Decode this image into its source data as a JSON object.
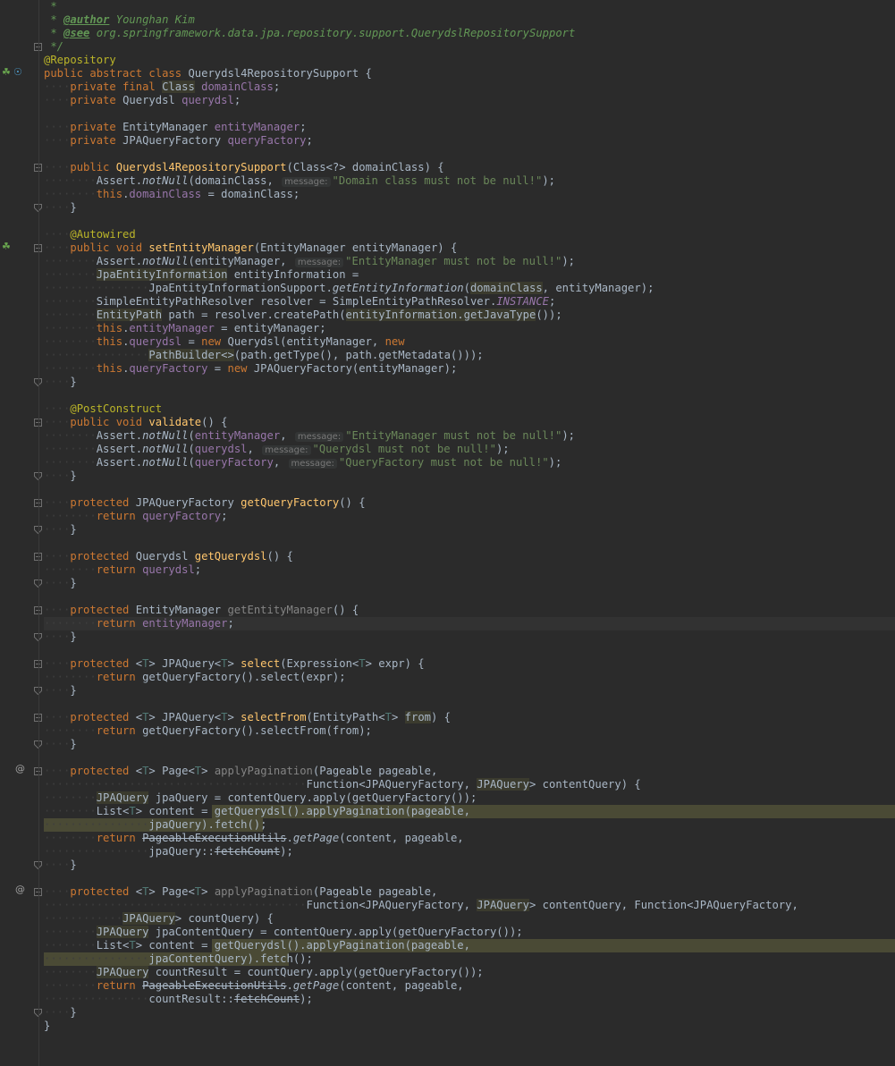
{
  "editor": {
    "lines": [
      [
        [
          "cm",
          " *"
        ]
      ],
      [
        [
          "cm",
          " * "
        ],
        [
          "tag",
          "@author"
        ],
        [
          "cm",
          " Younghan Kim"
        ]
      ],
      [
        [
          "cm",
          " * "
        ],
        [
          "tag",
          "@see"
        ],
        [
          "cm",
          " org.springframework.data.jpa.repository.support.QuerydslRepositorySupport"
        ]
      ],
      [
        [
          "cm",
          " */"
        ]
      ],
      [
        [
          "ann",
          "@Repository"
        ]
      ],
      [
        [
          "kw",
          "public abstract class "
        ],
        [
          "",
          "Querydsl4RepositorySupport {"
        ]
      ],
      [
        [
          "ws",
          "····"
        ],
        [
          "kw",
          "private final "
        ],
        [
          "mark",
          "Class"
        ],
        [
          "fld",
          " domainClass"
        ],
        [
          "",
          ";"
        ]
      ],
      [
        [
          "ws",
          "····"
        ],
        [
          "kw",
          "private "
        ],
        [
          "",
          "Querydsl "
        ],
        [
          "fld",
          "querydsl"
        ],
        [
          "",
          ";"
        ]
      ],
      [],
      [
        [
          "ws",
          "····"
        ],
        [
          "kw",
          "private "
        ],
        [
          "",
          "EntityManager "
        ],
        [
          "fld",
          "entityManager"
        ],
        [
          "",
          ";"
        ]
      ],
      [
        [
          "ws",
          "····"
        ],
        [
          "kw",
          "private "
        ],
        [
          "",
          "JPAQueryFactory "
        ],
        [
          "fld",
          "queryFactory"
        ],
        [
          "",
          ";"
        ]
      ],
      [],
      [
        [
          "ws",
          "····"
        ],
        [
          "kw",
          "public "
        ],
        [
          "fn",
          "Querydsl4RepositorySupport"
        ],
        [
          "",
          "(Class<?> domainClass) {"
        ]
      ],
      [
        [
          "ws",
          "········"
        ],
        [
          "",
          "Assert."
        ],
        [
          "st",
          "notNull"
        ],
        [
          "",
          "(domainClass, "
        ],
        [
          "hint",
          "message:"
        ],
        [
          "str",
          "\"Domain class must not be null!\""
        ],
        [
          "",
          ");"
        ]
      ],
      [
        [
          "ws",
          "········"
        ],
        [
          "kw",
          "this"
        ],
        [
          "",
          "."
        ],
        [
          "fld",
          "domainClass"
        ],
        [
          "",
          " = domainClass;"
        ]
      ],
      [
        [
          "ws",
          "····"
        ],
        [
          "",
          "}"
        ]
      ],
      [],
      [
        [
          "ws",
          "····"
        ],
        [
          "ann",
          "@Autowired"
        ]
      ],
      [
        [
          "ws",
          "····"
        ],
        [
          "kw",
          "public void "
        ],
        [
          "fn",
          "setEntityManager"
        ],
        [
          "",
          "(EntityManager entityManager) {"
        ]
      ],
      [
        [
          "ws",
          "········"
        ],
        [
          "",
          "Assert."
        ],
        [
          "st",
          "notNull"
        ],
        [
          "",
          "(entityManager, "
        ],
        [
          "hint",
          "message:"
        ],
        [
          "str",
          "\"EntityManager must not be null!\""
        ],
        [
          "",
          ");"
        ]
      ],
      [
        [
          "ws",
          "········"
        ],
        [
          "mark",
          "JpaEntityInformation"
        ],
        [
          "",
          " entityInformation ="
        ]
      ],
      [
        [
          "ws",
          "················"
        ],
        [
          "",
          "JpaEntityInformationSupport."
        ],
        [
          "st",
          "getEntityInformation"
        ],
        [
          "",
          "("
        ],
        [
          "mark",
          "domainClass"
        ],
        [
          "",
          ", entityManager);"
        ]
      ],
      [
        [
          "ws",
          "········"
        ],
        [
          "",
          "SimpleEntityPathResolver resolver = SimpleEntityPathResolver."
        ],
        [
          "fld st",
          "INSTANCE"
        ],
        [
          "",
          ";"
        ]
      ],
      [
        [
          "ws",
          "········"
        ],
        [
          "mark",
          "EntityPath"
        ],
        [
          "",
          " path = resolver.createPath("
        ],
        [
          "mark",
          "entityInformation.getJavaType"
        ],
        [
          "",
          "());"
        ]
      ],
      [
        [
          "ws",
          "········"
        ],
        [
          "kw",
          "this"
        ],
        [
          "",
          "."
        ],
        [
          "fld",
          "entityManager"
        ],
        [
          "",
          " = entityManager;"
        ]
      ],
      [
        [
          "ws",
          "········"
        ],
        [
          "kw",
          "this"
        ],
        [
          "",
          "."
        ],
        [
          "fld",
          "querydsl"
        ],
        [
          "",
          " = "
        ],
        [
          "kw",
          "new "
        ],
        [
          "",
          "Querydsl(entityManager, "
        ],
        [
          "kw",
          "new"
        ]
      ],
      [
        [
          "ws",
          "················"
        ],
        [
          "mark",
          "PathBuilder<>"
        ],
        [
          "",
          "(path.getType(), path.getMetadata()));"
        ]
      ],
      [
        [
          "ws",
          "········"
        ],
        [
          "kw",
          "this"
        ],
        [
          "",
          "."
        ],
        [
          "fld",
          "queryFactory"
        ],
        [
          "",
          " = "
        ],
        [
          "kw",
          "new "
        ],
        [
          "",
          "JPAQueryFactory(entityManager);"
        ]
      ],
      [
        [
          "ws",
          "····"
        ],
        [
          "",
          "}"
        ]
      ],
      [],
      [
        [
          "ws",
          "····"
        ],
        [
          "ann",
          "@PostConstruct"
        ]
      ],
      [
        [
          "ws",
          "····"
        ],
        [
          "kw",
          "public void "
        ],
        [
          "fn",
          "validate"
        ],
        [
          "",
          "() {"
        ]
      ],
      [
        [
          "ws",
          "········"
        ],
        [
          "",
          "Assert."
        ],
        [
          "st",
          "notNull"
        ],
        [
          "",
          "("
        ],
        [
          "fld",
          "entityManager"
        ],
        [
          "",
          ", "
        ],
        [
          "hint",
          "message:"
        ],
        [
          "str",
          "\"EntityManager must not be null!\""
        ],
        [
          "",
          ");"
        ]
      ],
      [
        [
          "ws",
          "········"
        ],
        [
          "",
          "Assert."
        ],
        [
          "st",
          "notNull"
        ],
        [
          "",
          "("
        ],
        [
          "fld",
          "querydsl"
        ],
        [
          "",
          ", "
        ],
        [
          "hint",
          "message:"
        ],
        [
          "str",
          "\"Querydsl must not be null!\""
        ],
        [
          "",
          ");"
        ]
      ],
      [
        [
          "ws",
          "········"
        ],
        [
          "",
          "Assert."
        ],
        [
          "st",
          "notNull"
        ],
        [
          "",
          "("
        ],
        [
          "fld",
          "queryFactory"
        ],
        [
          "",
          ", "
        ],
        [
          "hint",
          "message:"
        ],
        [
          "str",
          "\"QueryFactory must not be null!\""
        ],
        [
          "",
          ");"
        ]
      ],
      [
        [
          "ws",
          "····"
        ],
        [
          "",
          "}"
        ]
      ],
      [],
      [
        [
          "ws",
          "····"
        ],
        [
          "kw",
          "protected "
        ],
        [
          "",
          "JPAQueryFactory "
        ],
        [
          "fn",
          "getQueryFactory"
        ],
        [
          "",
          "() {"
        ]
      ],
      [
        [
          "ws",
          "········"
        ],
        [
          "kw",
          "return "
        ],
        [
          "fld",
          "queryFactory"
        ],
        [
          "",
          ";"
        ]
      ],
      [
        [
          "ws",
          "····"
        ],
        [
          "",
          "}"
        ]
      ],
      [],
      [
        [
          "ws",
          "····"
        ],
        [
          "kw",
          "protected "
        ],
        [
          "",
          "Querydsl "
        ],
        [
          "fn",
          "getQuerydsl"
        ],
        [
          "",
          "() {"
        ]
      ],
      [
        [
          "ws",
          "········"
        ],
        [
          "kw",
          "return "
        ],
        [
          "fld",
          "querydsl"
        ],
        [
          "",
          ";"
        ]
      ],
      [
        [
          "ws",
          "····"
        ],
        [
          "",
          "}"
        ]
      ],
      [],
      [
        [
          "ws",
          "····"
        ],
        [
          "kw",
          "protected "
        ],
        [
          "",
          "EntityManager "
        ],
        [
          "dim",
          "getEntityManager"
        ],
        [
          "",
          "() {"
        ]
      ],
      [
        [
          "ws",
          "········"
        ],
        [
          "kw",
          "return "
        ],
        [
          "fld",
          "entityManager"
        ],
        [
          "",
          ";"
        ]
      ],
      [
        [
          "ws",
          "····"
        ],
        [
          "",
          "}"
        ]
      ],
      [],
      [
        [
          "ws",
          "····"
        ],
        [
          "kw",
          "protected "
        ],
        [
          "",
          "<"
        ],
        [
          "tp",
          "T"
        ],
        [
          "",
          "> JPAQuery<"
        ],
        [
          "tp",
          "T"
        ],
        [
          "",
          "> "
        ],
        [
          "fn",
          "select"
        ],
        [
          "",
          "(Expression<"
        ],
        [
          "tp",
          "T"
        ],
        [
          "",
          "> expr) {"
        ]
      ],
      [
        [
          "ws",
          "········"
        ],
        [
          "kw",
          "return "
        ],
        [
          "",
          "getQueryFactory().select(expr);"
        ]
      ],
      [
        [
          "ws",
          "····"
        ],
        [
          "",
          "}"
        ]
      ],
      [],
      [
        [
          "ws",
          "····"
        ],
        [
          "kw",
          "protected "
        ],
        [
          "",
          "<"
        ],
        [
          "tp",
          "T"
        ],
        [
          "",
          "> JPAQuery<"
        ],
        [
          "tp",
          "T"
        ],
        [
          "",
          "> "
        ],
        [
          "fn",
          "selectFrom"
        ],
        [
          "",
          "(EntityPath<"
        ],
        [
          "tp",
          "T"
        ],
        [
          "",
          "> "
        ],
        [
          "mark",
          "from"
        ],
        [
          "",
          ") {"
        ]
      ],
      [
        [
          "ws",
          "········"
        ],
        [
          "kw",
          "return "
        ],
        [
          "",
          "getQueryFactory().selectFrom(from);"
        ]
      ],
      [
        [
          "ws",
          "····"
        ],
        [
          "",
          "}"
        ]
      ],
      [],
      [
        [
          "ws",
          "····"
        ],
        [
          "kw",
          "protected "
        ],
        [
          "",
          "<"
        ],
        [
          "tp",
          "T"
        ],
        [
          "",
          "> Page<"
        ],
        [
          "tp",
          "T"
        ],
        [
          "",
          "> "
        ],
        [
          "dim",
          "applyPagination"
        ],
        [
          "",
          "(Pageable pageable,"
        ]
      ],
      [
        [
          "ws",
          "········································"
        ],
        [
          "",
          "Function<JPAQueryFactory, "
        ],
        [
          "mark",
          "JPAQuery"
        ],
        [
          "",
          "> contentQuery) {"
        ]
      ],
      [
        [
          "ws",
          "········"
        ],
        [
          "mark",
          "JPAQuery"
        ],
        [
          "",
          " jpaQuery = contentQuery.apply(getQueryFactory());"
        ]
      ],
      [
        [
          "ws",
          "········"
        ],
        [
          "",
          "List<"
        ],
        [
          "tp",
          "T"
        ],
        [
          "",
          "> content = getQuerydsl().applyPagination(pageable,"
        ]
      ],
      [
        [
          "ws",
          "················"
        ],
        [
          "",
          "jpaQuery).fetch();"
        ]
      ],
      [
        [
          "ws",
          "········"
        ],
        [
          "kw",
          "return "
        ],
        [
          "strike",
          "PageableExecutionUtils"
        ],
        [
          "",
          "."
        ],
        [
          "st",
          "getPage"
        ],
        [
          "",
          "(content, pageable,"
        ]
      ],
      [
        [
          "ws",
          "················"
        ],
        [
          "",
          "jpaQuery::"
        ],
        [
          "strike",
          "fetchCount"
        ],
        [
          "",
          ");"
        ]
      ],
      [
        [
          "ws",
          "····"
        ],
        [
          "",
          "}"
        ]
      ],
      [],
      [
        [
          "ws",
          "····"
        ],
        [
          "kw",
          "protected "
        ],
        [
          "",
          "<"
        ],
        [
          "tp",
          "T"
        ],
        [
          "",
          "> Page<"
        ],
        [
          "tp",
          "T"
        ],
        [
          "",
          "> "
        ],
        [
          "dim",
          "applyPagination"
        ],
        [
          "",
          "(Pageable pageable,"
        ]
      ],
      [
        [
          "ws",
          "········································"
        ],
        [
          "",
          "Function<JPAQueryFactory, "
        ],
        [
          "mark",
          "JPAQuery"
        ],
        [
          "",
          "> contentQuery, Function<JPAQueryFactory,"
        ]
      ],
      [
        [
          "ws",
          "············"
        ],
        [
          "mark",
          "JPAQuery"
        ],
        [
          "",
          "> countQuery) {"
        ]
      ],
      [
        [
          "ws",
          "········"
        ],
        [
          "mark",
          "JPAQuery"
        ],
        [
          "",
          " jpaContentQuery = contentQuery.apply(getQueryFactory());"
        ]
      ],
      [
        [
          "ws",
          "········"
        ],
        [
          "",
          "List<"
        ],
        [
          "tp",
          "T"
        ],
        [
          "",
          "> content = getQuerydsl().applyPagination(pageable,"
        ]
      ],
      [
        [
          "ws",
          "················"
        ],
        [
          "",
          "jpaContentQuery).fetch();"
        ]
      ],
      [
        [
          "ws",
          "········"
        ],
        [
          "mark",
          "JPAQuery"
        ],
        [
          "",
          " countResult = countQuery.apply(getQueryFactory());"
        ]
      ],
      [
        [
          "ws",
          "········"
        ],
        [
          "kw",
          "return "
        ],
        [
          "strike",
          "PageableExecutionUtils"
        ],
        [
          "",
          "."
        ],
        [
          "st",
          "getPage"
        ],
        [
          "",
          "(content, pageable,"
        ]
      ],
      [
        [
          "ws",
          "················"
        ],
        [
          "",
          "countResult::"
        ],
        [
          "strike",
          "fetchCount"
        ],
        [
          "",
          ");"
        ]
      ],
      [
        [
          "ws",
          "····"
        ],
        [
          "",
          "}"
        ]
      ],
      [
        [
          "",
          "}"
        ]
      ]
    ]
  },
  "colors": {
    "background": "#2b2b2b",
    "keyword": "#cc7832",
    "annotation": "#bbb529",
    "method": "#ffc66d",
    "field": "#9876aa",
    "string": "#6a8759",
    "comment": "#629755"
  }
}
